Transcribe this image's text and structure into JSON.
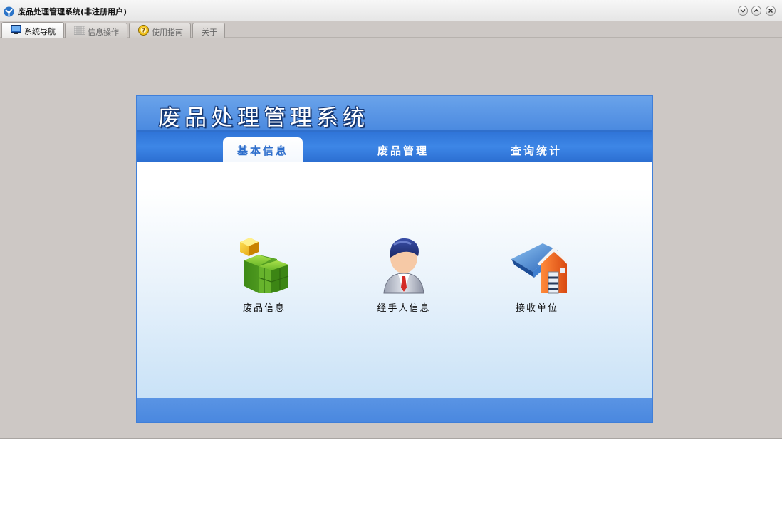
{
  "window": {
    "title": "废品处理管理系统(非注册用户)",
    "controls": [
      "minimize-icon",
      "maximize-icon",
      "close-icon"
    ]
  },
  "tabs": [
    {
      "label": "系统导航",
      "icon": "monitor-icon",
      "active": true
    },
    {
      "label": "信息操作",
      "icon": "grid-icon",
      "active": false
    },
    {
      "label": "使用指南",
      "icon": "help-icon",
      "active": false
    },
    {
      "label": "关于",
      "icon": "",
      "active": false
    }
  ],
  "panel": {
    "banner_title": "废品处理管理系统",
    "nav": [
      {
        "label": "基本信息",
        "active": true
      },
      {
        "label": "废品管理",
        "active": false
      },
      {
        "label": "查询统计",
        "active": false
      }
    ],
    "modules": [
      {
        "label": "废品信息",
        "icon": "green-cubes-icon"
      },
      {
        "label": "经手人信息",
        "icon": "person-icon"
      },
      {
        "label": "接收单位",
        "icon": "building-icon"
      }
    ]
  },
  "colors": {
    "banner": "#4b8ae0",
    "navbar": "#2f74d8",
    "window_bg": "#cdc8c5",
    "accent_text": "#2f6fcc"
  }
}
